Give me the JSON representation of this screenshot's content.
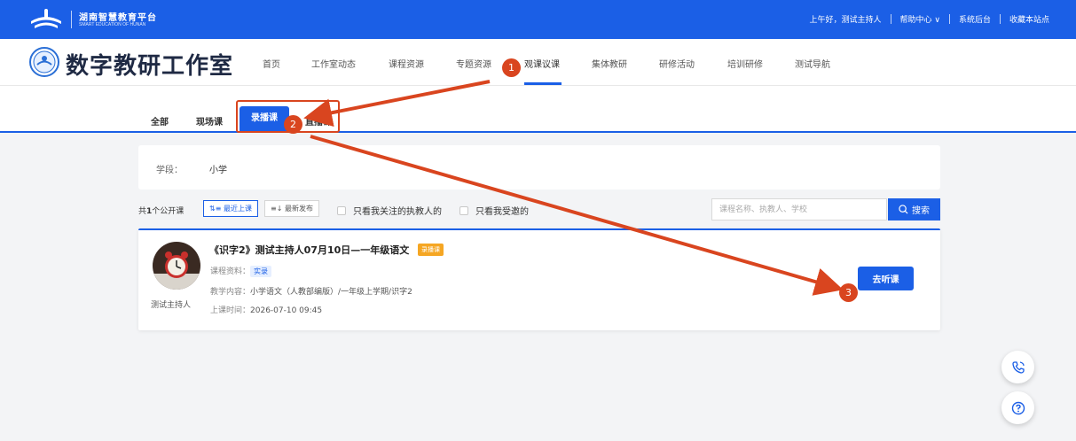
{
  "topbar": {
    "brand_cn": "湖南智慧教育平台",
    "brand_en": "SMART EDUCATION OF HUNAN",
    "greeting": "上午好，测试主持人",
    "help": "帮助中心 ∨",
    "admin": "系统后台",
    "favorite": "收藏本站点"
  },
  "header": {
    "title": "数字教研工作室",
    "nav": [
      "首页",
      "工作室动态",
      "课程资源",
      "专题资源",
      "观课议课",
      "集体教研",
      "研修活动",
      "培训研修",
      "测试导航"
    ],
    "active_nav": "观课议课"
  },
  "subtabs": {
    "items": [
      "全部",
      "现场课",
      "录播课",
      "直播课"
    ],
    "active": "录播课",
    "hidden_text": "自"
  },
  "filter": {
    "label": "学段：",
    "value": "小学"
  },
  "toolbar": {
    "count_prefix": "共",
    "count": "1",
    "count_suffix": "个公开课",
    "sort_recent": "⇅≡ 最近上课",
    "sort_new": "≡↓ 最新发布",
    "check_follow": "只看我关注的执教人的",
    "check_invited": "只看我受邀的",
    "search_placeholder": "课程名称、执教人、学校",
    "search_label": "搜索"
  },
  "course": {
    "title": "《识字2》测试主持人07月10日—一年级语文",
    "badge": "录播课",
    "teacher": "测试主持人",
    "material_label": "课程资料：",
    "material_tag": "实录",
    "content_label": "教学内容：",
    "content_value": "小学语文（人教部编版）/一年级上学期/识字2",
    "time_label": "上课时间：",
    "time_value": "2026-07-10 09:45",
    "action": "去听课"
  },
  "annotations": {
    "marker1": "1",
    "marker2": "2",
    "marker3": "3",
    "color": "#d9451f"
  },
  "colors": {
    "primary": "#1b5fe6",
    "badge": "#f5a623"
  },
  "icons": {
    "phone": "phone-icon",
    "help": "question-icon",
    "search": "search-icon"
  }
}
